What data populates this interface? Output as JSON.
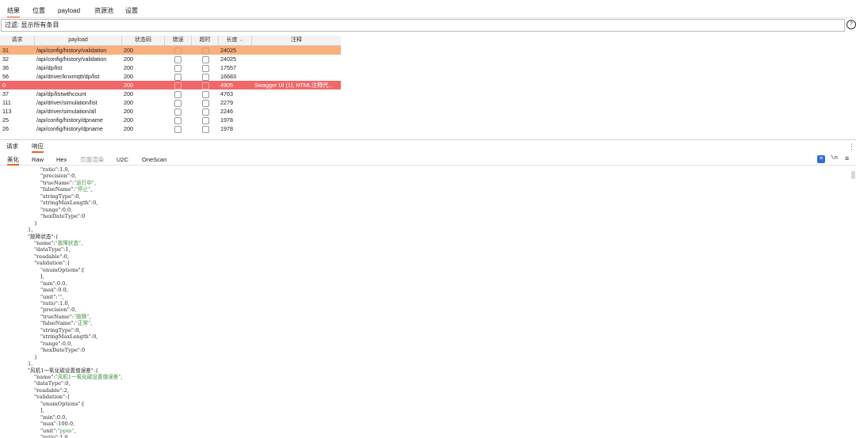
{
  "top_tabs": [
    "结果",
    "位置",
    "payload",
    "资源池",
    "设置"
  ],
  "filter": {
    "text": "过滤: 显示所有条目",
    "help": "?"
  },
  "table": {
    "columns": [
      "请求",
      "payload",
      "状态码",
      "错误",
      "超时",
      "长度",
      "注释"
    ],
    "rows": [
      {
        "req": "31",
        "payload": "/api/config/history/validation",
        "status": "200",
        "length": "24025",
        "comment": "",
        "style": "sel"
      },
      {
        "req": "32",
        "payload": "/api/config/history/validation",
        "status": "200",
        "length": "24025",
        "comment": "",
        "style": ""
      },
      {
        "req": "36",
        "payload": "/api/dp/list",
        "status": "200",
        "length": "17557",
        "comment": "",
        "style": ""
      },
      {
        "req": "56",
        "payload": "/api/driver/knxmqtt/dp/list",
        "status": "200",
        "length": "16683",
        "comment": "",
        "style": ""
      },
      {
        "req": "0",
        "payload": "",
        "status": "200",
        "length": "4905",
        "comment": "Swagger UI (1), HTML注释代...",
        "style": "hl"
      },
      {
        "req": "37",
        "payload": "/api/dp/listwithcount",
        "status": "200",
        "length": "4763",
        "comment": "",
        "style": ""
      },
      {
        "req": "111",
        "payload": "/api/driver/simulation/list",
        "status": "200",
        "length": "2279",
        "comment": "",
        "style": ""
      },
      {
        "req": "113",
        "payload": "/api/driver/simulation/all",
        "status": "200",
        "length": "2246",
        "comment": "",
        "style": ""
      },
      {
        "req": "25",
        "payload": "/api/config/history/dpname",
        "status": "200",
        "length": "1978",
        "comment": "",
        "style": ""
      },
      {
        "req": "26",
        "payload": "/api/config/history/dpname",
        "status": "200",
        "length": "1978",
        "comment": "",
        "style": ""
      }
    ]
  },
  "panel_tabs": [
    "请求",
    "响应"
  ],
  "sub_tabs": [
    "美化",
    "Raw",
    "Hex",
    "页面渲染",
    "U2C",
    "OneScan"
  ],
  "toolbar": {
    "wrap_icon": "wrap-lines-icon",
    "newline": "\\n",
    "menu_icon": "hamburger-menu-icon"
  },
  "code_lines": [
    {
      "i": 3,
      "t": "\"ratio\":1.0,"
    },
    {
      "i": 3,
      "t": "\"precision\":0,"
    },
    {
      "i": 3,
      "t": "\"trueName\":\"运行中\","
    },
    {
      "i": 3,
      "t": "\"falseName\":\"停止\","
    },
    {
      "i": 3,
      "t": "\"stringType\":0,"
    },
    {
      "i": 3,
      "t": "\"stringMaxLength\":0,"
    },
    {
      "i": 3,
      "t": "\"range\":0.0,"
    },
    {
      "i": 3,
      "t": "\"hexDateType\":0"
    },
    {
      "i": 2,
      "t": "}"
    },
    {
      "i": 1,
      "t": "},"
    },
    {
      "i": 1,
      "t": "\"故障状态\":{"
    },
    {
      "i": 2,
      "t": "\"name\":\"故障状态\","
    },
    {
      "i": 2,
      "t": "\"dataType\":1,"
    },
    {
      "i": 2,
      "t": "\"readable\":0,"
    },
    {
      "i": 2,
      "t": "\"validation\":{"
    },
    {
      "i": 3,
      "t": "\"enumOptions\":["
    },
    {
      "i": 3,
      "t": "],"
    },
    {
      "i": 3,
      "t": "\"min\":0.0,"
    },
    {
      "i": 3,
      "t": "\"max\":0.0,"
    },
    {
      "i": 3,
      "t": "\"unit\":\"\","
    },
    {
      "i": 3,
      "t": "\"ratio\":1.0,"
    },
    {
      "i": 3,
      "t": "\"precision\":0,"
    },
    {
      "i": 3,
      "t": "\"trueName\":\"故障\","
    },
    {
      "i": 3,
      "t": "\"falseName\":\"正常\","
    },
    {
      "i": 3,
      "t": "\"stringType\":0,"
    },
    {
      "i": 3,
      "t": "\"stringMaxLength\":0,"
    },
    {
      "i": 3,
      "t": "\"range\":0.0,"
    },
    {
      "i": 3,
      "t": "\"hexDateType\":0"
    },
    {
      "i": 2,
      "t": "}"
    },
    {
      "i": 1,
      "t": "},"
    },
    {
      "i": 1,
      "t": "\"风机1一氧化碳设置值误差\":{"
    },
    {
      "i": 2,
      "t": "\"name\":\"风机1一氧化碳设置值误差\","
    },
    {
      "i": 2,
      "t": "\"dataType\":0,"
    },
    {
      "i": 2,
      "t": "\"readable\":2,"
    },
    {
      "i": 2,
      "t": "\"validation\":{"
    },
    {
      "i": 3,
      "t": "\"enumOptions\":["
    },
    {
      "i": 3,
      "t": "],"
    },
    {
      "i": 3,
      "t": "\"min\":0.0,"
    },
    {
      "i": 3,
      "t": "\"max\":100.0,"
    },
    {
      "i": 3,
      "t": "\"unit\":\"ppm\","
    },
    {
      "i": 3,
      "t": "\"ratio\":1.0,"
    }
  ]
}
